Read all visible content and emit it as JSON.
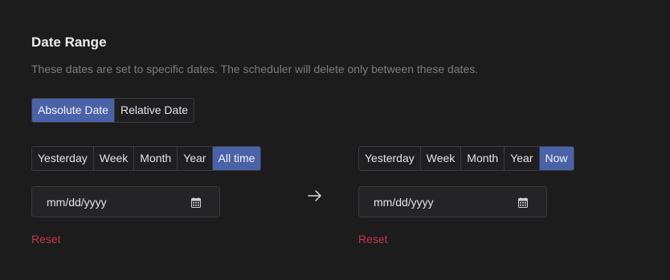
{
  "section": {
    "title": "Date Range",
    "description": "These dates are set to specific dates. The scheduler will delete only between these dates."
  },
  "mode": {
    "options": [
      "Absolute Date",
      "Relative Date"
    ],
    "selected": "Absolute Date"
  },
  "start": {
    "presets": [
      "Yesterday",
      "Week",
      "Month",
      "Year",
      "All time"
    ],
    "selected": "All time",
    "placeholder": "mm/dd/yyyy",
    "reset_label": "Reset"
  },
  "end": {
    "presets": [
      "Yesterday",
      "Week",
      "Month",
      "Year",
      "Now"
    ],
    "selected": "Now",
    "placeholder": "mm/dd/yyyy",
    "reset_label": "Reset"
  },
  "colors": {
    "background": "#1c1c1d",
    "accent": "#4a62a8",
    "reset": "#c5334d"
  },
  "icons": {
    "date_input": "calendar-icon",
    "separator": "arrow-right-icon"
  }
}
